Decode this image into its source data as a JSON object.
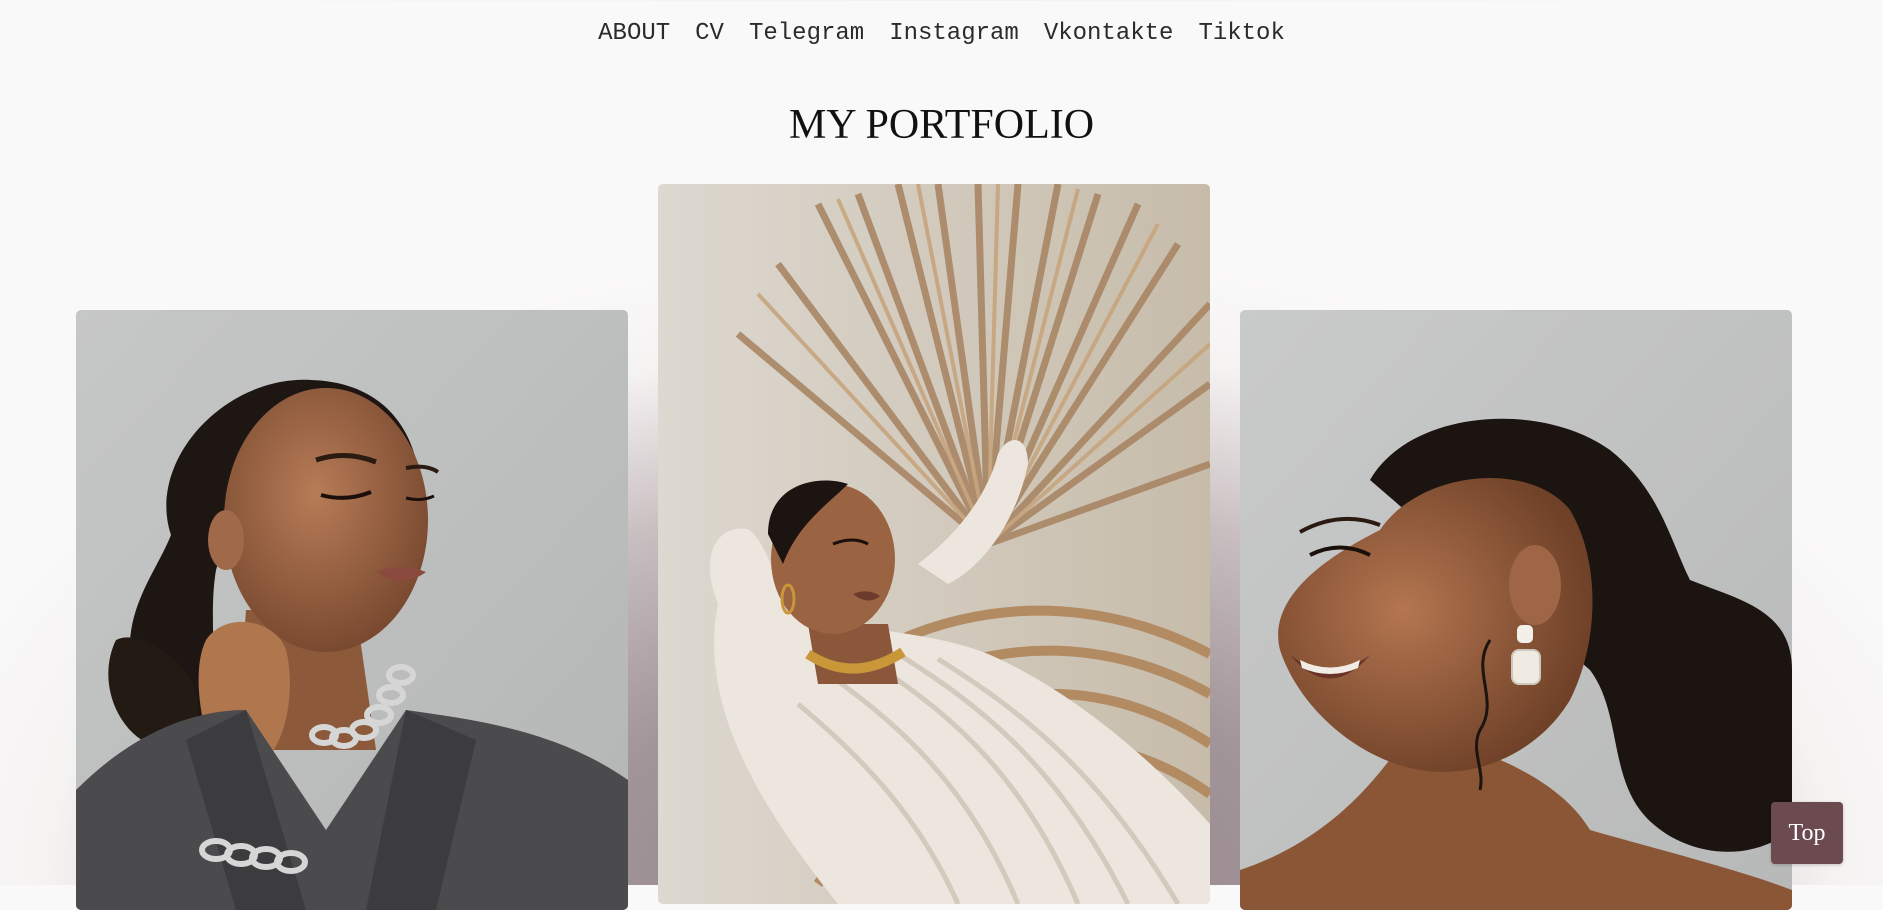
{
  "nav": {
    "items": [
      {
        "label": "ABOUT"
      },
      {
        "label": "CV"
      },
      {
        "label": "Telegram"
      },
      {
        "label": "Instagram"
      },
      {
        "label": "Vkontakte"
      },
      {
        "label": "Tiktok"
      }
    ]
  },
  "page": {
    "title": "MY PORTFOLIO"
  },
  "gallery": {
    "photos": [
      {
        "subject": "woman in grey blazer with silver chain necklace, hand at neck"
      },
      {
        "subject": "woman in white knit dress reclining on rattan chair before dried palm fan"
      },
      {
        "subject": "woman smiling in profile wearing pearl drop earring"
      }
    ]
  },
  "controls": {
    "top_label": "Top"
  },
  "colors": {
    "accent": "#6b4a50",
    "background_glow": "#8f7f82"
  }
}
